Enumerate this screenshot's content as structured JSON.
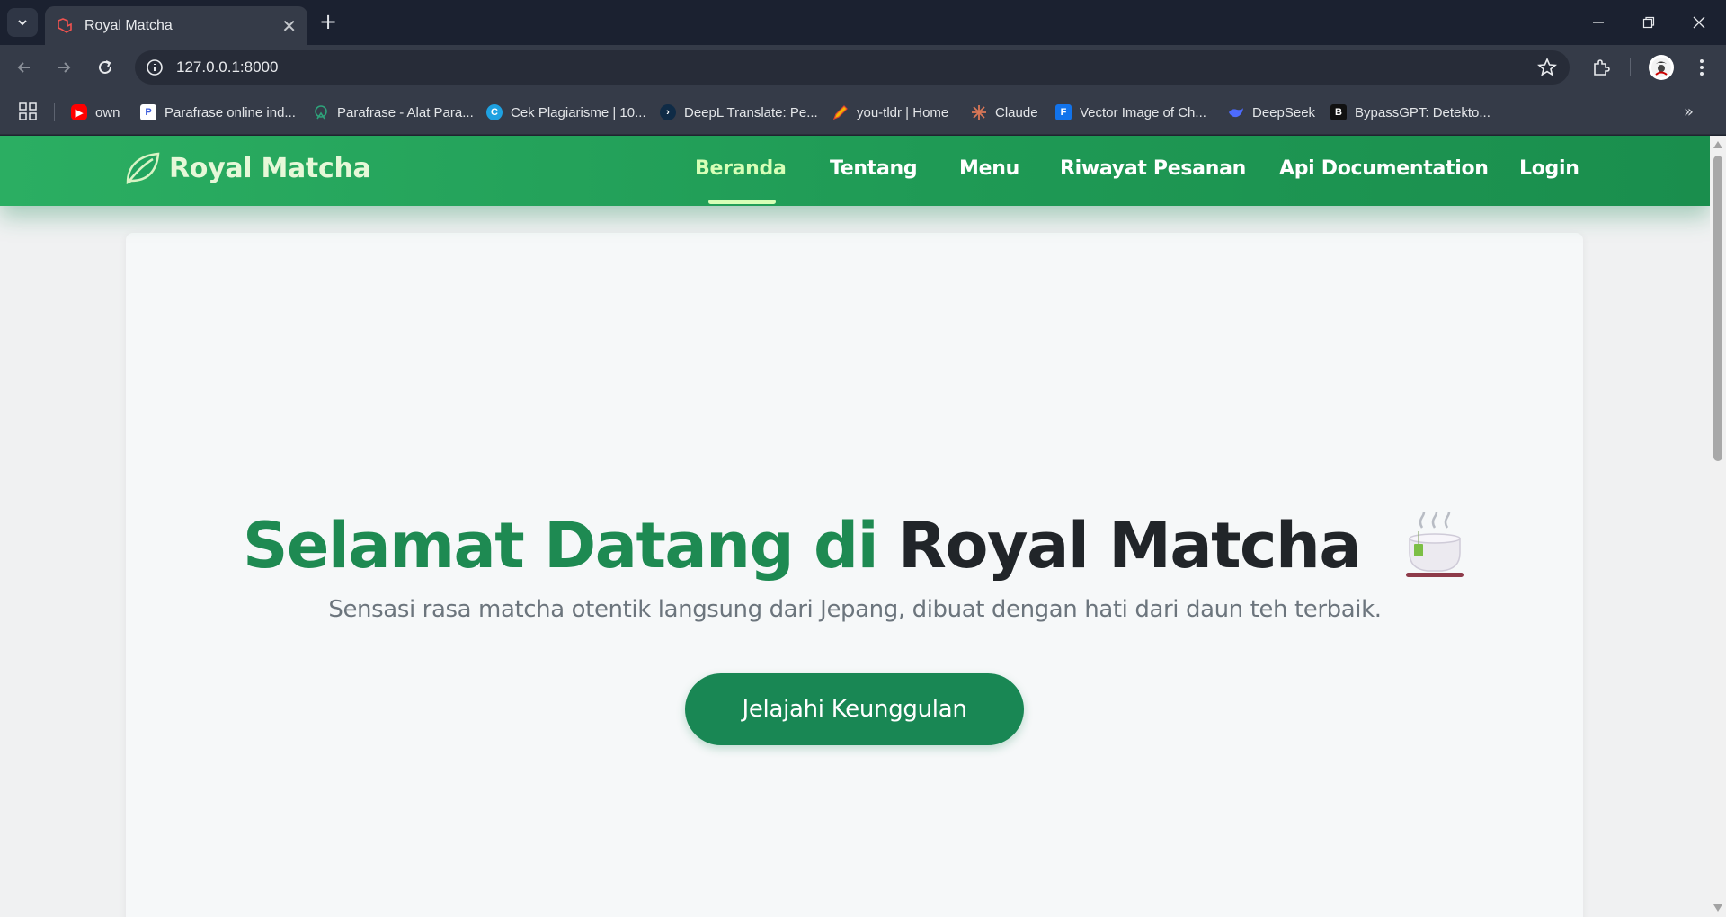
{
  "browser": {
    "tab": {
      "title": "Royal Matcha",
      "close": "✕"
    },
    "new_tab": "+",
    "url": "127.0.0.1:8000",
    "bookmarks": [
      {
        "label": "own",
        "icon": "youtube-icon",
        "color": "#ff0000"
      },
      {
        "label": "Parafrase online ind...",
        "icon": "paraphrase-p-icon",
        "color": "#ffffff"
      },
      {
        "label": "Parafrase - Alat Para...",
        "icon": "paraphrase-tool-icon",
        "color": "#2ea37a"
      },
      {
        "label": "Cek Plagiarisme | 10...",
        "icon": "plagiarism-c-icon",
        "color": "#1ea1e1"
      },
      {
        "label": "DeepL Translate: Pe...",
        "icon": "deepl-icon",
        "color": "#0f2b46"
      },
      {
        "label": "you-tldr | Home",
        "icon": "pencil-icon",
        "color": "#f4b400"
      },
      {
        "label": "Claude",
        "icon": "claude-icon",
        "color": "#d97757"
      },
      {
        "label": "Vector Image of Ch...",
        "icon": "freepik-icon",
        "color": "#1273eb"
      },
      {
        "label": "DeepSeek",
        "icon": "deepseek-whale-icon",
        "color": "#4d6bfe"
      },
      {
        "label": "BypassGPT: Detekto...",
        "icon": "bypassgpt-b-icon",
        "color": "#111111"
      }
    ],
    "bookmarks_more": "»"
  },
  "site": {
    "brand": "Royal Matcha",
    "nav": [
      "Beranda",
      "Tentang",
      "Menu",
      "Riwayat Pesanan",
      "Api Documentation",
      "Login"
    ],
    "active_nav": "Beranda",
    "hero": {
      "title_green": "Selamat Datang di",
      "title_dark": "Royal Matcha",
      "title_icon": "tea-cup-icon",
      "subtitle": "Sensasi rasa matcha otentik langsung dari Jepang, dibuat dengan hati dari daun teh terbaik.",
      "button": "Jelajahi Keunggulan"
    }
  },
  "colors": {
    "nav_green": "#1f9a55",
    "active_link": "#d7ffb7",
    "title_green": "#1e8a52",
    "button_green": "#198754"
  }
}
